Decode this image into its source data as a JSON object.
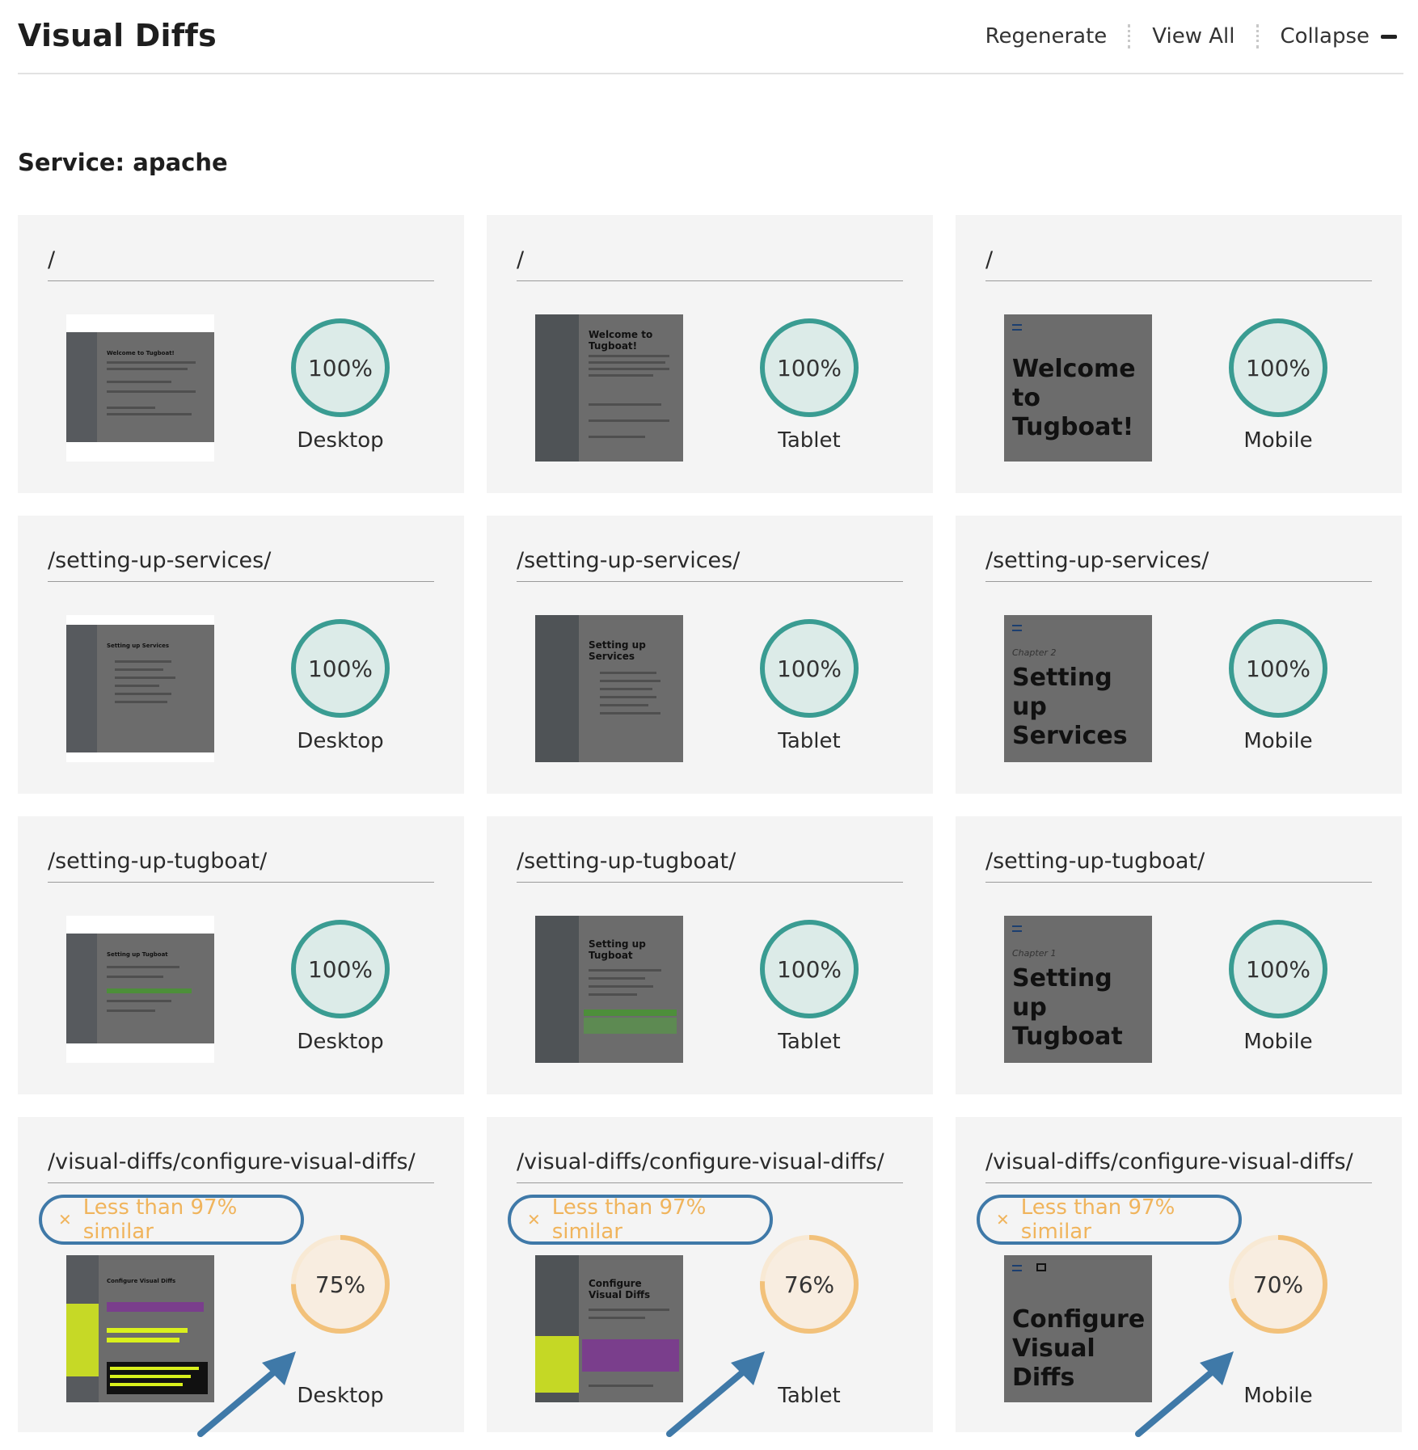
{
  "header": {
    "title": "Visual Diffs",
    "actions": {
      "regenerate": "Regenerate",
      "view_all": "View All",
      "collapse": "Collapse"
    }
  },
  "service": {
    "title": "Service: apache"
  },
  "cards": [
    {
      "path": "/",
      "percent": "100%",
      "device": "Desktop"
    },
    {
      "path": "/",
      "percent": "100%",
      "device": "Tablet"
    },
    {
      "path": "/",
      "percent": "100%",
      "device": "Mobile"
    },
    {
      "path": "/setting-up-services/",
      "percent": "100%",
      "device": "Desktop"
    },
    {
      "path": "/setting-up-services/",
      "percent": "100%",
      "device": "Tablet"
    },
    {
      "path": "/setting-up-services/",
      "percent": "100%",
      "device": "Mobile"
    },
    {
      "path": "/setting-up-tugboat/",
      "percent": "100%",
      "device": "Desktop"
    },
    {
      "path": "/setting-up-tugboat/",
      "percent": "100%",
      "device": "Tablet"
    },
    {
      "path": "/setting-up-tugboat/",
      "percent": "100%",
      "device": "Mobile"
    },
    {
      "path": "/visual-diffs/configure-visual-diffs/",
      "percent": "75%",
      "device": "Desktop",
      "warning": "Less than 97% similar"
    },
    {
      "path": "/visual-diffs/configure-visual-diffs/",
      "percent": "76%",
      "device": "Tablet",
      "warning": "Less than 97% similar"
    },
    {
      "path": "/visual-diffs/configure-visual-diffs/",
      "percent": "70%",
      "device": "Mobile",
      "warning": "Less than 97% similar"
    }
  ],
  "thumbs": {
    "welcome_small": "Welcome to Tugboat!",
    "welcome_tablet": "Welcome to Tugboat!",
    "welcome_mobile": "Welcome to Tugboat!",
    "services_small": "Setting up Services",
    "services_tablet": "Setting up Services",
    "services_chapter": "Chapter 2",
    "services_mobile": "Setting up Services",
    "tugboat_small": "Setting up Tugboat",
    "tugboat_tablet": "Setting up Tugboat",
    "tugboat_chapter": "Chapter 1",
    "tugboat_mobile": "Setting up Tugboat",
    "config_small": "Configure Visual Diffs",
    "config_tablet": "Configure Visual Diffs",
    "config_mobile": "Configure Visual Diffs"
  },
  "colors": {
    "ok_ring": "#3a9c92",
    "ok_fill": "#dcebe8",
    "warn_ring": "#f2c17a",
    "warn_track": "#f8e9d4",
    "warn_fill": "#f8ede0",
    "warn_text": "#f0b45c",
    "annotation": "#3f79a8"
  },
  "icons": {
    "badge": "close-x-icon",
    "collapse": "minus-icon",
    "annotation": "arrow-icon"
  }
}
